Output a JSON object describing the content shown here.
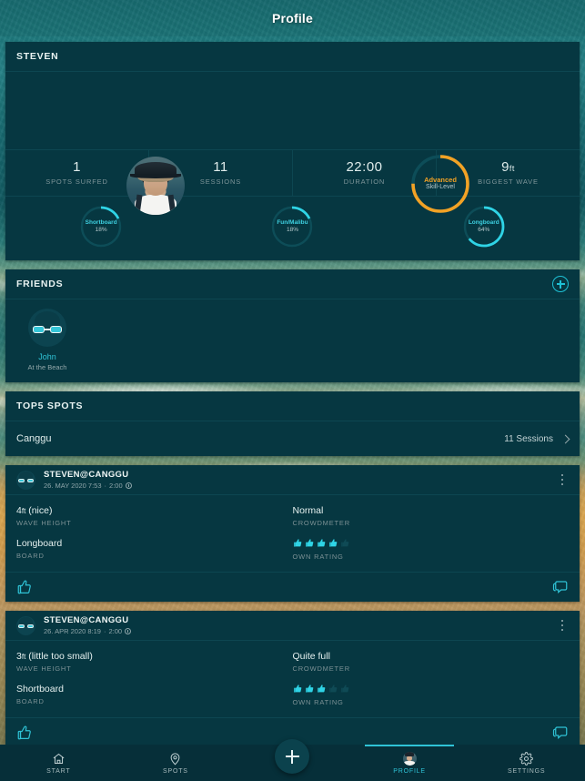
{
  "header": {
    "title": "Profile"
  },
  "profile": {
    "section_title": "STEVEN",
    "avatar_name": "user-photo",
    "skill": {
      "level": "Advanced",
      "label": "Skill-Level",
      "percent": 75,
      "color": "#f2a225"
    },
    "stats": [
      {
        "value": "1",
        "unit": "",
        "label": "SPOTS SURFED"
      },
      {
        "value": "11",
        "unit": "",
        "label": "SESSIONS"
      },
      {
        "value": "22:00",
        "unit": "",
        "label": "DURATION"
      },
      {
        "value": "9",
        "unit": "ft",
        "label": "BIGGEST WAVE"
      }
    ],
    "boards": [
      {
        "name": "Shortboard",
        "percent_label": "18%",
        "percent": 18
      },
      {
        "name": "Fun/Malibu",
        "percent_label": "18%",
        "percent": 18
      },
      {
        "name": "Longboard",
        "percent_label": "64%",
        "percent": 64
      }
    ]
  },
  "friends": {
    "section_title": "FRIENDS",
    "add_icon": "plus-circle-icon",
    "items": [
      {
        "name": "John",
        "status": "At the Beach"
      }
    ]
  },
  "top_spots": {
    "section_title": "TOP5 SPOTS",
    "items": [
      {
        "name": "Canggu",
        "sessions": "11 Sessions"
      }
    ]
  },
  "sessions": [
    {
      "title": "STEVEN@CANGGU",
      "date": "26. MAY 2020 7:53",
      "duration": "2:00",
      "wave_height_value": "4",
      "wave_height_unit": "ft",
      "wave_height_note": " (nice)",
      "wave_height_label": "WAVE HEIGHT",
      "crowd_value": "Normal",
      "crowd_label": "CROWDMETER",
      "board_value": "Longboard",
      "board_label": "BOARD",
      "rating": 4,
      "rating_max": 5,
      "rating_label": "OWN RATING",
      "like_icon": "thumbs-up-icon",
      "comment_icon": "comment-bubble-icon",
      "menu_icon": "kebab-menu-icon"
    },
    {
      "title": "STEVEN@CANGGU",
      "date": "26. APR 2020 8:19",
      "duration": "2:00",
      "wave_height_value": "3",
      "wave_height_unit": "ft",
      "wave_height_note": " (little too small)",
      "wave_height_label": "WAVE HEIGHT",
      "crowd_value": "Quite full",
      "crowd_label": "CROWDMETER",
      "board_value": "Shortboard",
      "board_label": "BOARD",
      "rating": 3,
      "rating_max": 5,
      "rating_label": "OWN RATING",
      "like_icon": "thumbs-up-icon",
      "comment_icon": "comment-bubble-icon",
      "menu_icon": "kebab-menu-icon"
    }
  ],
  "bottom_nav": {
    "items": [
      {
        "label": "START",
        "icon": "home-icon",
        "active": false
      },
      {
        "label": "SPOTS",
        "icon": "map-pin-icon",
        "active": false
      },
      {
        "label": "",
        "icon": "plus-fab-icon",
        "active": false
      },
      {
        "label": "PROFILE",
        "icon": "avatar-icon",
        "active": true
      },
      {
        "label": "SETTINGS",
        "icon": "gear-icon",
        "active": false
      }
    ]
  },
  "colors": {
    "accent": "#2fc3d6",
    "orange": "#f2a225",
    "card_bg": "#063741",
    "nav_bg": "#062f39"
  }
}
